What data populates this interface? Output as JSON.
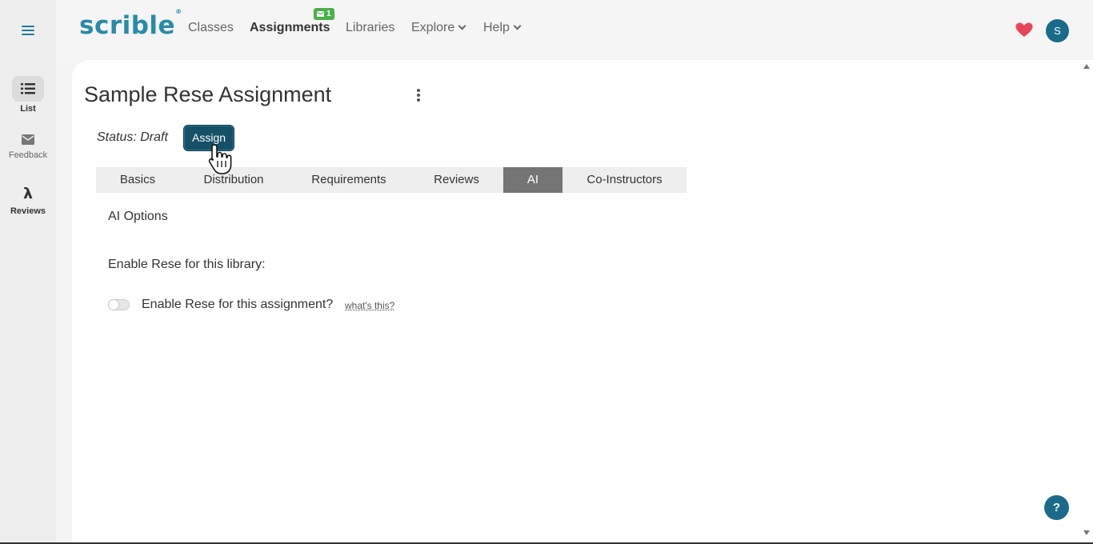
{
  "app": {
    "logo_text": "scrible",
    "logo_mark": "®"
  },
  "rail": {
    "items": [
      {
        "label": "List",
        "icon": "list-icon"
      },
      {
        "label": "Feedback",
        "icon": "envelope-icon"
      },
      {
        "label": "Reviews",
        "icon": "lambda-icon"
      }
    ]
  },
  "nav": {
    "items": [
      {
        "label": "Classes"
      },
      {
        "label": "Assignments",
        "active": true
      },
      {
        "label": "Libraries"
      },
      {
        "label": "Explore",
        "dropdown": true
      },
      {
        "label": "Help",
        "dropdown": true
      }
    ],
    "badge_count": "1",
    "avatar_initial": "S"
  },
  "page": {
    "title": "Sample Rese Assignment",
    "status_text": "Status: Draft",
    "assign_label": "Assign",
    "tabs": [
      {
        "label": "Basics"
      },
      {
        "label": "Distribution"
      },
      {
        "label": "Requirements"
      },
      {
        "label": "Reviews"
      },
      {
        "label": "AI",
        "active": true
      },
      {
        "label": "Co-Instructors"
      }
    ],
    "ai_options_heading": "AI Options",
    "library_label": "Enable Rese for this library:",
    "assignment_toggle_label": "Enable Rese for this assignment?",
    "assignment_toggle_on": false,
    "whats_this": "what's this?",
    "help_label": "?"
  },
  "colors": {
    "brand": "#2a8aa8",
    "primary_button": "#165066",
    "active_tab": "#757575",
    "badge": "#4cae4c",
    "heart": "#e8455a"
  }
}
